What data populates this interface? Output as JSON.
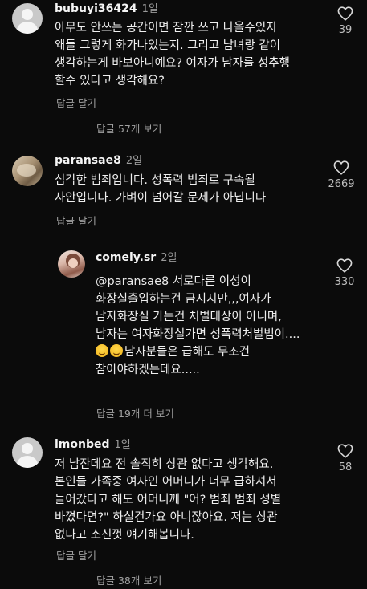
{
  "comments": [
    {
      "username": "bubuyi36424",
      "time": "1일",
      "text": "아무도 안쓰는 공간이면 잠깐 쓰고 나올수있지\n왜들 그렇게 화가나있는지. 그리고 남녀랑 같이\n생각하는게 바보아니예요? 여자가 남자를 성추행\n할수 있다고 생각해요?",
      "reply_label": "답글 달기",
      "likes": "39",
      "view_replies": "답글 57개 보기"
    },
    {
      "username": "paransae8",
      "time": "2일",
      "text": "심각한 범죄입니다. 성폭력 범죄로 구속될\n사안입니다. 가벼이 넘어갈 문제가 아닙니다",
      "reply_label": "답글 달기",
      "likes": "2669"
    },
    {
      "username": "comely.sr",
      "time": "2일",
      "mention": "@paransae8",
      "text_a": " 서로다른 이성이\n화장실출입하는건 금지지만,,,여자가\n남자화장실 가는건 처벌대상이 아니며,\n남자는 여자화장실가면 성폭력처벌법이....",
      "text_b": "남자분들은 급해도 무조건\n참아야하겠는데요.....",
      "likes": "330",
      "view_replies": "답글 19개 더 보기"
    },
    {
      "username": "imonbed",
      "time": "1일",
      "text": "저 남잔데요 전 솔직히 상관 없다고 생각해요.\n본인들 가족중 여자인 어머니가 너무 급하셔서\n들어갔다고 해도 어머니께 \"어? 범죄 범죄 성별\n바꼈다면?\" 하실건가요 아니잖아요. 저는 상관\n없다고 소신껏 얘기해봅니다.",
      "reply_label": "답글 달기",
      "likes": "58",
      "view_replies": "답글 38개 보기"
    }
  ]
}
